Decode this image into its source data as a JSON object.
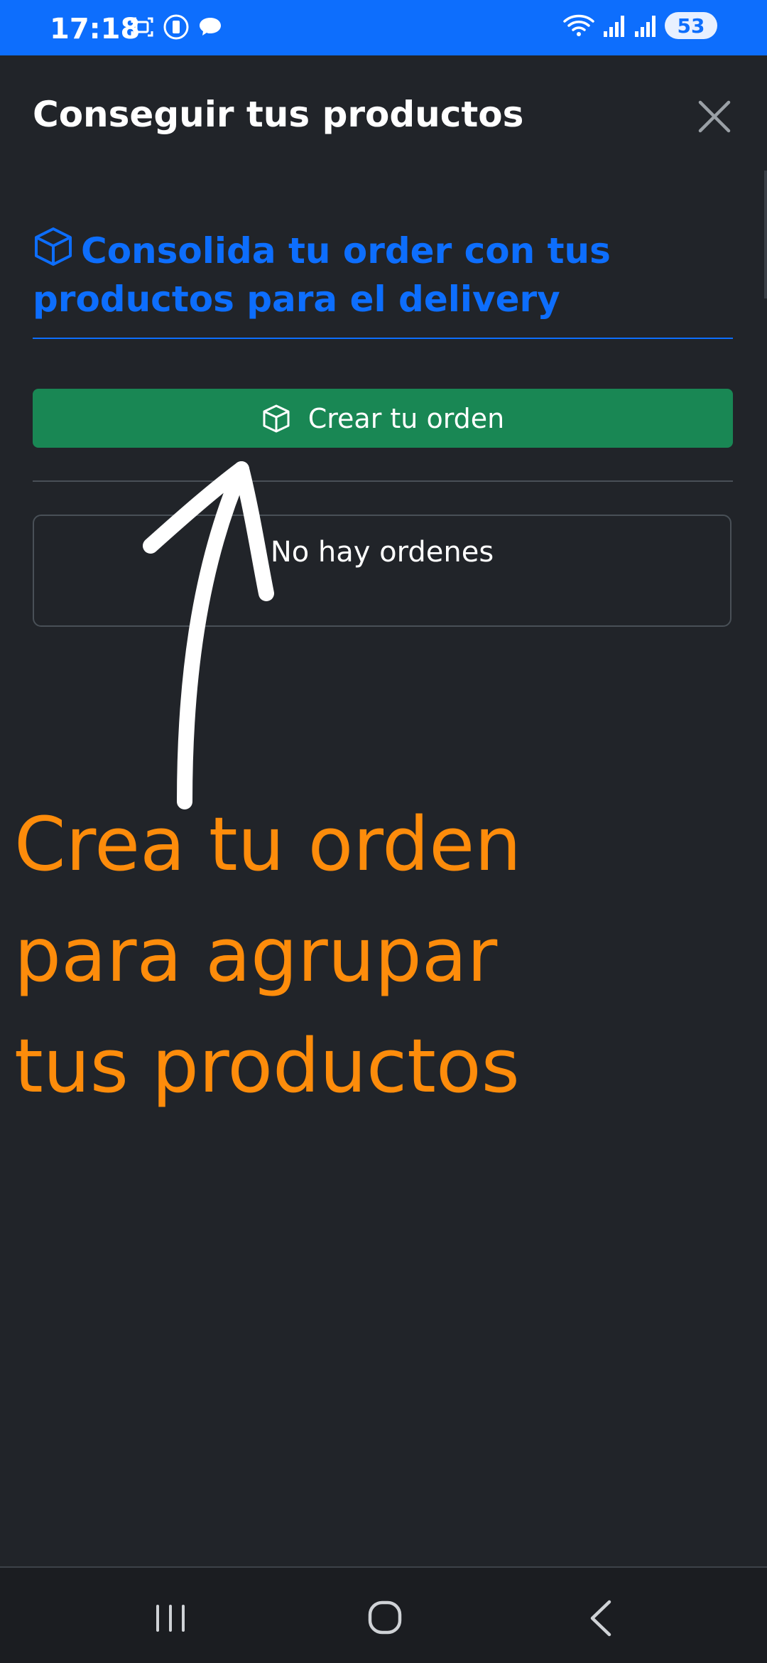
{
  "status_bar": {
    "time": "17:18",
    "battery": "53",
    "left_icons": [
      "screenshot-icon",
      "vibrate-icon",
      "chat-icon"
    ],
    "right_icons": [
      "wifi-icon",
      "signal-icon",
      "signal-icon",
      "battery-icon"
    ]
  },
  "modal": {
    "title": "Conseguir tus productos",
    "headline": "Consolida tu order con tus productos para el delivery",
    "create_button_label": "Crear tu orden",
    "empty_message": "No hay ordenes"
  },
  "annotation": {
    "text": "Crea tu orden\n para agrupar\ntus productos",
    "color": "#fd8c0b"
  },
  "colors": {
    "primary": "#0d6efd",
    "success": "#198754",
    "background": "#212429"
  },
  "nav_bar": {
    "buttons": [
      "recent-apps-icon",
      "home-icon",
      "back-icon"
    ]
  }
}
